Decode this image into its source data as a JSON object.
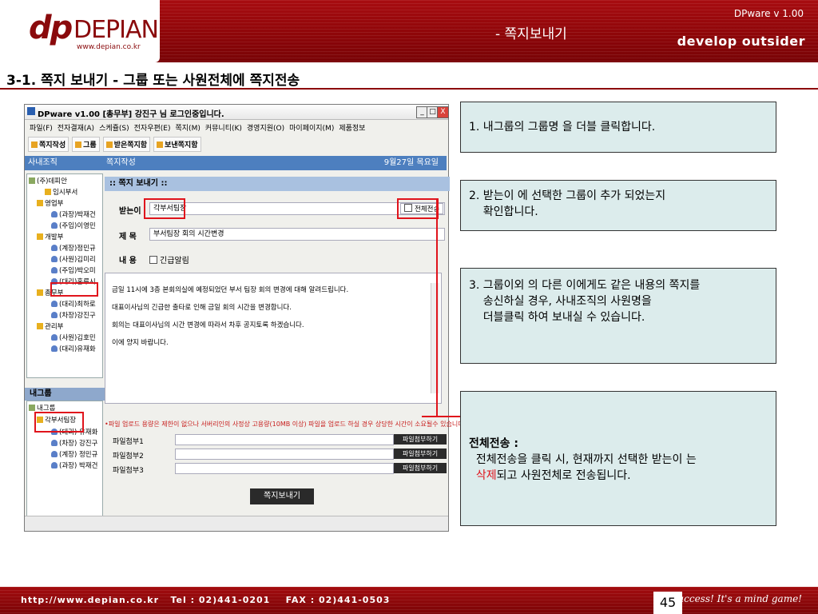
{
  "header": {
    "brand_mark": "dp",
    "brand_name": "DEPIAN",
    "brand_url": "www.depian.co.kr",
    "page_title": "- 쪽지보내기",
    "version": "DPware v 1.00",
    "slogan": "develop outsider"
  },
  "section": {
    "title": "3-1. 쪽지 보내기 - 그룹 또는 사원전체에 쪽지전송"
  },
  "app": {
    "window_title": "DPware v1.00   [총무부] 강진구 님 로그인중입니다.",
    "window_buttons": [
      "_",
      "□",
      "X"
    ],
    "menu": [
      "파일(F)",
      "전자결재(A)",
      "스케쥴(S)",
      "전자우편(E)",
      "쪽지(M)",
      "커뮤니티(K)",
      "경영지원(O)",
      "마이페이지(M)",
      "제품정보"
    ],
    "toolbar": [
      "쪽지작성",
      "그룹",
      "받은쪽지함",
      "보낸쪽지함"
    ],
    "sidebar_title": "사내조직",
    "tree": [
      {
        "label": "(주)데피안",
        "icon": "root"
      },
      {
        "label": "임시부서",
        "icon": "folder"
      },
      {
        "label": "영업부",
        "icon": "folder"
      },
      {
        "label": "(과장)박재건",
        "icon": "user"
      },
      {
        "label": "(주임)이영민",
        "icon": "user"
      },
      {
        "label": "개발부",
        "icon": "folder"
      },
      {
        "label": "(계장)정민규",
        "icon": "user"
      },
      {
        "label": "(사원)김미리",
        "icon": "user"
      },
      {
        "label": "(주임)박오미",
        "icon": "user"
      },
      {
        "label": "(대리)홍루시",
        "icon": "user"
      },
      {
        "label": "총무부",
        "icon": "folder"
      },
      {
        "label": "(대리)최하로",
        "icon": "user"
      },
      {
        "label": "(차장)강진구",
        "icon": "user"
      },
      {
        "label": "관리부",
        "icon": "folder"
      },
      {
        "label": "(사원)김호민",
        "icon": "user"
      },
      {
        "label": "(대리)유재화",
        "icon": "user"
      }
    ],
    "mygroup_title": "내그룹",
    "mygroup": [
      {
        "label": "내그룹",
        "icon": "root"
      },
      {
        "label": "각부서팀장",
        "icon": "folder"
      },
      {
        "label": "(대리) 유재화",
        "icon": "user"
      },
      {
        "label": "(차장) 강진구",
        "icon": "user"
      },
      {
        "label": "(계장) 정민규",
        "icon": "user"
      },
      {
        "label": "(과장) 박재건",
        "icon": "user"
      }
    ],
    "main_title": "쪽지작성",
    "date": "9월27일 목요일",
    "form_title": ":: 쪽지 보내기 ::",
    "to_label": "받는이",
    "to_value": "각부서팀장",
    "send_all_label": "전체전송",
    "subject_label": "제 목",
    "subject_value": "부서팀장 회의 시간변경",
    "content_label": "내 용",
    "urgent_label": "긴급알림",
    "body_lines": [
      "금일 11시에 3층 본회의실에 예정되었던 부서 팀장 회의 변경에 대해 알려드립니다.",
      "대표이사님의 긴급한 출타로 인해 금일 회의 시간을 변경합니다.",
      "회의는 대표이사님의 시간 변경에 따라서 차후 공지토록 하겠습니다.",
      "이에 양지 바랍니다."
    ],
    "upload_notice": "•파일 업로드 용량은 제한이 없으나 서버리인의 사정상 고용량(10MB 이상) 파일을 업로드 하실 경우 상당한 시간이 소요될수 있습니다.",
    "attachments": [
      {
        "label": "파일첨부1",
        "button": "파일첨부하기"
      },
      {
        "label": "파일첨부2",
        "button": "파일첨부하기"
      },
      {
        "label": "파일첨부3",
        "button": "파일첨부하기"
      }
    ],
    "send_button": "쪽지보내기"
  },
  "callouts": {
    "c1": "1. 내그룹의 그룹명 을 더블 클릭합니다.",
    "c2_line1": "2. 받는이 에 선택한 그룹이 추가 되었는지",
    "c2_line2": "    확인합니다.",
    "c3_line1": "3. 그룹이외 의 다른 이에게도 같은 내용의 쪽지를",
    "c3_line2": "    송신하실 경우, 사내조직의 사원명을",
    "c3_line3": "    더블클릭 하여 보내실 수 있습니다.",
    "c4_title": "전체전송 :",
    "c4_line1": "  전체전송을 클릭 시, 현재까지 선택한 받는이 는",
    "c4_red": "  삭제",
    "c4_rest": "되고 사원전체로 전송됩니다."
  },
  "footer": {
    "contact": "http://www.depian.co.kr   Tel : 02)441-0201    FAX : 02)441-0503",
    "page_number": "45",
    "slogan": "Success! It's a mind game!"
  },
  "colors": {
    "brand_red": "#8c0508",
    "highlight_red": "#e0141c",
    "callout_bg": "#dcecec",
    "app_blue": "#4d7fbf"
  }
}
